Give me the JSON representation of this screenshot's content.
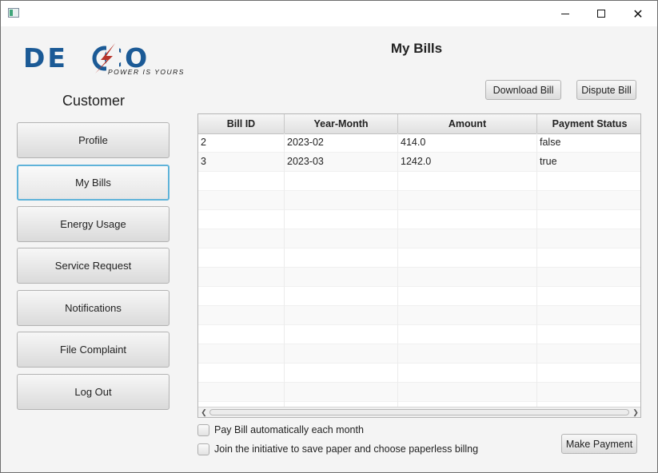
{
  "window": {
    "min_icon": "minimize-icon",
    "max_icon": "maximize-icon",
    "close_icon": "close-icon",
    "close_glyph": "✕"
  },
  "logo": {
    "text_left": "DE",
    "text_right": "CO",
    "tagline": "POWER IS YOURS",
    "brand_blue": "#1b5a96",
    "bolt_red": "#b8342b"
  },
  "sidebar": {
    "role": "Customer",
    "items": [
      {
        "label": "Profile"
      },
      {
        "label": "My Bills"
      },
      {
        "label": "Energy Usage"
      },
      {
        "label": "Service Request"
      },
      {
        "label": "Notifications"
      },
      {
        "label": "File Complaint"
      },
      {
        "label": "Log Out"
      }
    ],
    "active_index": 1,
    "active_border": "#5fb3d9"
  },
  "main": {
    "title": "My Bills",
    "download_label": "Download Bill",
    "dispute_label": "Dispute Bill",
    "make_payment_label": "Make Payment",
    "table": {
      "columns": [
        "Bill ID",
        "Year-Month",
        "Amount",
        "Payment Status"
      ],
      "rows": [
        [
          "2",
          "2023-02",
          "414.0",
          "false"
        ],
        [
          "3",
          "2023-03",
          "1242.0",
          "true"
        ]
      ]
    },
    "auto_pay_label": "Pay Bill automatically each month",
    "paperless_label": "Join the initiative to save paper and choose paperless billng"
  }
}
